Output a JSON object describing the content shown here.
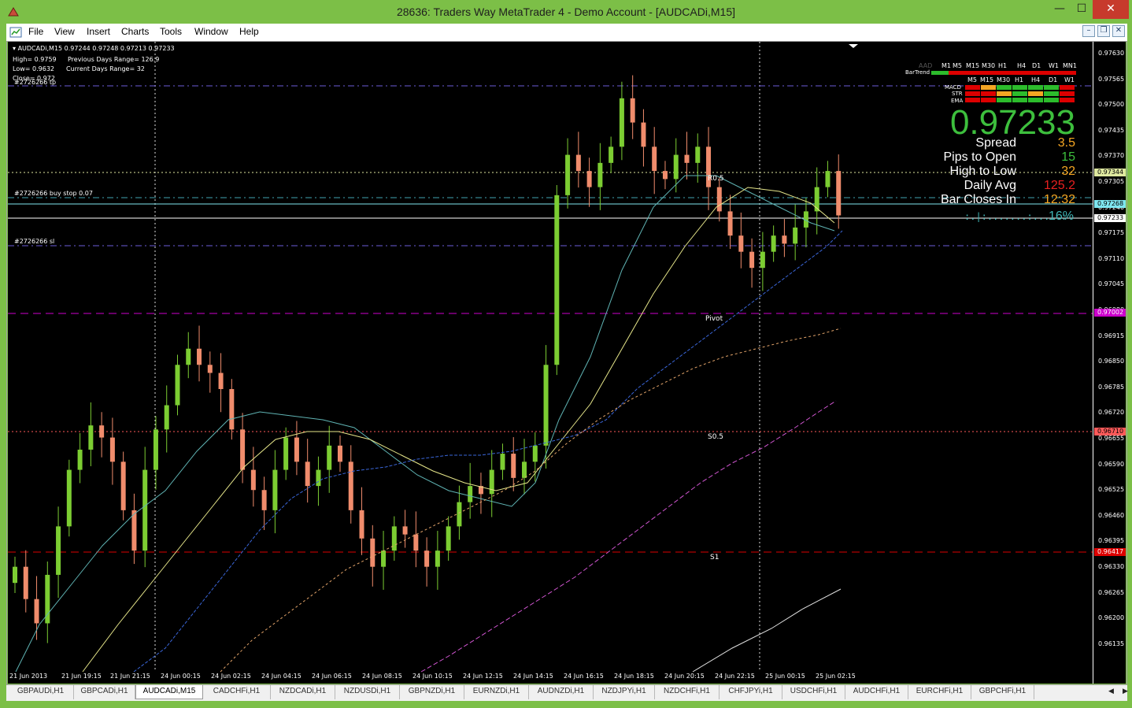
{
  "window": {
    "title": "28636: Traders Way MetaTrader 4 - Demo Account - [AUDCADi,M15]",
    "minimize": "—",
    "maximize": "☐",
    "close": "✕"
  },
  "menu": [
    "File",
    "View",
    "Insert",
    "Charts",
    "Tools",
    "Window",
    "Help"
  ],
  "chart_info": {
    "symbol_line": "AUDCADi,M15  0.97244 0.97248 0.97213 0.97233",
    "high": "High= 0.9759",
    "prev_range": "Previous Days Range= 126.9",
    "low": "Low= 0.9632",
    "cur_range": "Current Days Range= 32",
    "close": "Close= 0.972",
    "tp_label": "#2726266 tp",
    "buystop_label": "#2726266 buy stop 0.07",
    "sl_label": "#2726266 sl"
  },
  "levels": {
    "r05": "R0.5",
    "pivot": "Pivot",
    "s05": "S0.5",
    "s1": "S1"
  },
  "price_axis": [
    "0.97630",
    "0.97565",
    "0.97500",
    "0.97435",
    "0.97370",
    "0.97305",
    "0.97240",
    "0.97175",
    "0.97110",
    "0.97045",
    "0.96980",
    "0.96915",
    "0.96850",
    "0.96785",
    "0.96720",
    "0.96655",
    "0.96590",
    "0.96525",
    "0.96460",
    "0.96395",
    "0.96330",
    "0.96265",
    "0.96200",
    "0.96135"
  ],
  "price_tags": [
    {
      "text": "0.97344",
      "bg": "#dfe9a0",
      "fg": "#000"
    },
    {
      "text": "0.97268",
      "bg": "#7fe6f0",
      "fg": "#000"
    },
    {
      "text": "0.97233",
      "bg": "#ffffff",
      "fg": "#000"
    },
    {
      "text": "0.97002",
      "bg": "#cc00cc",
      "fg": "#fff"
    },
    {
      "text": "0.96710",
      "bg": "#ff5a5a",
      "fg": "#000"
    },
    {
      "text": "0.96417",
      "bg": "#dd0000",
      "fg": "#fff"
    }
  ],
  "time_axis": [
    "21 Jun 2013",
    "21 Jun 19:15",
    "21 Jun 21:15",
    "24 Jun 00:15",
    "24 Jun 02:15",
    "24 Jun 04:15",
    "24 Jun 06:15",
    "24 Jun 08:15",
    "24 Jun 10:15",
    "24 Jun 12:15",
    "24 Jun 14:15",
    "24 Jun 16:15",
    "24 Jun 18:15",
    "24 Jun 20:15",
    "24 Jun 22:15",
    "25 Jun 00:15",
    "25 Jun 02:15"
  ],
  "panel": {
    "price": "0.97233",
    "spread_label": "Spread",
    "spread": "3.5",
    "pips_label": "Pips to Open",
    "pips": "15",
    "hl_label": "High to Low",
    "hl": "32",
    "avg_label": "Daily Avg",
    "avg": "125.2",
    "bar_label": "Bar Closes In",
    "bar": "12:32",
    "progress_text": ":.|:.......:.....:",
    "progress_pct": "16%",
    "tf_row1": [
      "M1",
      "M5",
      "M15",
      "M30",
      "H1",
      "H4",
      "D1",
      "W1",
      "MN1"
    ],
    "tf_row2": [
      "M5",
      "M15",
      "M30",
      "H1",
      "H4",
      "D1",
      "W1"
    ],
    "aad": "AAD",
    "bartrend": "BarTrend",
    "macd": "MACD",
    "str": "STR",
    "ema": "EMA"
  },
  "tabs": [
    "GBPAUDi,H1",
    "GBPCADi,H1",
    "AUDCADi,M15",
    "CADCHFi,H1",
    "NZDCADi,H1",
    "NZDUSDi,H1",
    "GBPNZDi,H1",
    "EURNZDi,H1",
    "AUDNZDi,H1",
    "NZDJPYi,H1",
    "NZDCHFi,H1",
    "CHFJPYi,H1",
    "USDCHFi,H1",
    "AUDCHFi,H1",
    "EURCHFi,H1",
    "GBPCHFi,H1"
  ],
  "active_tab": "AUDCADi,M15",
  "colors": {
    "bull": "#7ccd32",
    "bear": "#f08c6c",
    "panel_price": "#3dbf3d"
  },
  "chart_data": {
    "type": "candlestick",
    "symbol": "AUDCADi",
    "timeframe": "M15",
    "ylim": [
      0.961,
      0.9766
    ],
    "approx_closes": [
      0.9636,
      0.9628,
      0.9622,
      0.9634,
      0.9646,
      0.966,
      0.9665,
      0.9671,
      0.9668,
      0.9662,
      0.965,
      0.964,
      0.966,
      0.967,
      0.9676,
      0.9686,
      0.969,
      0.9686,
      0.9684,
      0.968,
      0.967,
      0.966,
      0.9655,
      0.965,
      0.966,
      0.9668,
      0.9662,
      0.9656,
      0.966,
      0.9666,
      0.9662,
      0.965,
      0.9643,
      0.9636,
      0.964,
      0.9646,
      0.9644,
      0.964,
      0.9636,
      0.964,
      0.9646,
      0.9652,
      0.9656,
      0.9654,
      0.966,
      0.9664,
      0.9658,
      0.9662,
      0.9666,
      0.9686,
      0.9728,
      0.9738,
      0.9734,
      0.973,
      0.9736,
      0.974,
      0.9752,
      0.9746,
      0.974,
      0.9734,
      0.9732,
      0.9738,
      0.9736,
      0.974,
      0.973,
      0.9724,
      0.9718,
      0.9714,
      0.971,
      0.9714,
      0.9718,
      0.9716,
      0.972,
      0.9724,
      0.973,
      0.9734,
      0.9723
    ]
  }
}
